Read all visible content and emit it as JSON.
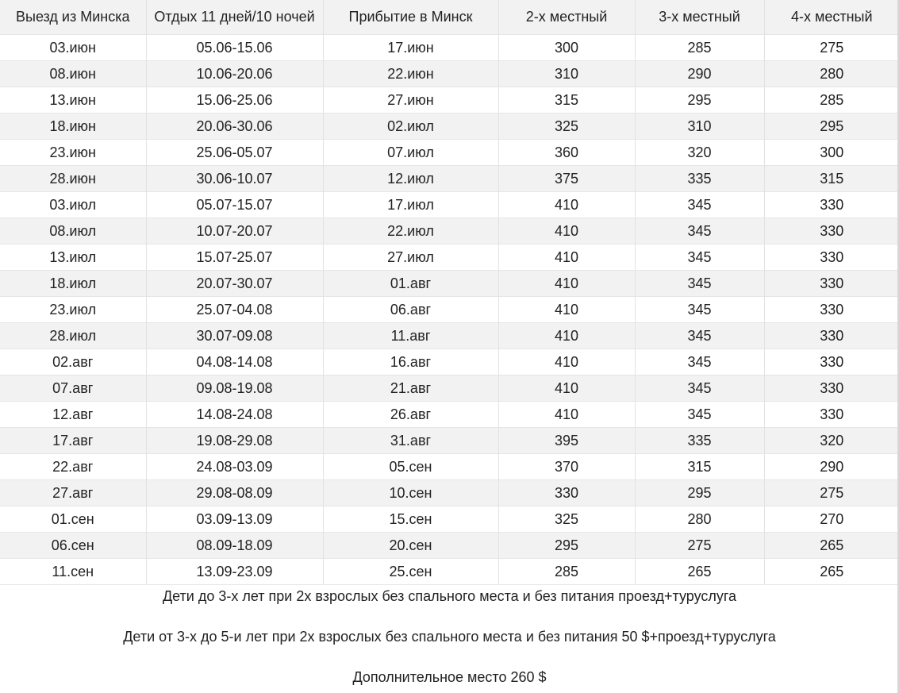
{
  "table": {
    "headers": [
      "Выезд из Минска",
      "Отдых 11 дней/10 ночей",
      "Прибытие в Минск",
      "2-х местный",
      "3-х местный",
      "4-х местный"
    ],
    "rows": [
      [
        "03.июн",
        "05.06-15.06",
        "17.июн",
        "300",
        "285",
        "275"
      ],
      [
        "08.июн",
        "10.06-20.06",
        "22.июн",
        "310",
        "290",
        "280"
      ],
      [
        "13.июн",
        "15.06-25.06",
        "27.июн",
        "315",
        "295",
        "285"
      ],
      [
        "18.июн",
        "20.06-30.06",
        "02.июл",
        "325",
        "310",
        "295"
      ],
      [
        "23.июн",
        "25.06-05.07",
        "07.июл",
        "360",
        "320",
        "300"
      ],
      [
        "28.июн",
        "30.06-10.07",
        "12.июл",
        "375",
        "335",
        "315"
      ],
      [
        "03.июл",
        "05.07-15.07",
        "17.июл",
        "410",
        "345",
        "330"
      ],
      [
        "08.июл",
        "10.07-20.07",
        "22.июл",
        "410",
        "345",
        "330"
      ],
      [
        "13.июл",
        "15.07-25.07",
        "27.июл",
        "410",
        "345",
        "330"
      ],
      [
        "18.июл",
        "20.07-30.07",
        "01.авг",
        "410",
        "345",
        "330"
      ],
      [
        "23.июл",
        "25.07-04.08",
        "06.авг",
        "410",
        "345",
        "330"
      ],
      [
        "28.июл",
        "30.07-09.08",
        "11.авг",
        "410",
        "345",
        "330"
      ],
      [
        "02.авг",
        "04.08-14.08",
        "16.авг",
        "410",
        "345",
        "330"
      ],
      [
        "07.авг",
        "09.08-19.08",
        "21.авг",
        "410",
        "345",
        "330"
      ],
      [
        "12.авг",
        "14.08-24.08",
        "26.авг",
        "410",
        "345",
        "330"
      ],
      [
        "17.авг",
        "19.08-29.08",
        "31.авг",
        "395",
        "335",
        "320"
      ],
      [
        "22.авг",
        "24.08-03.09",
        "05.сен",
        "370",
        "315",
        "290"
      ],
      [
        "27.авг",
        "29.08-08.09",
        "10.сен",
        "330",
        "295",
        "275"
      ],
      [
        "01.сен",
        "03.09-13.09",
        "15.сен",
        "325",
        "280",
        "270"
      ],
      [
        "06.сен",
        "08.09-18.09",
        "20.сен",
        "295",
        "275",
        "265"
      ],
      [
        "11.сен",
        "13.09-23.09",
        "25.сен",
        "285",
        "265",
        "265"
      ]
    ]
  },
  "notes": [
    "Дети до 3-х лет при 2х взрослых без спального места и без питания проезд+туруслуга",
    "Дети от 3-х до 5-и лет при 2х взрослых без спального места и без питания 50 $+проезд+туруслуга",
    "Дополнительное место 260 $"
  ],
  "colors": {
    "header_bg": "#f2f2f2",
    "stripe_bg": "#f2f2f2",
    "text": "#222222",
    "border": "#e2e2e2"
  }
}
